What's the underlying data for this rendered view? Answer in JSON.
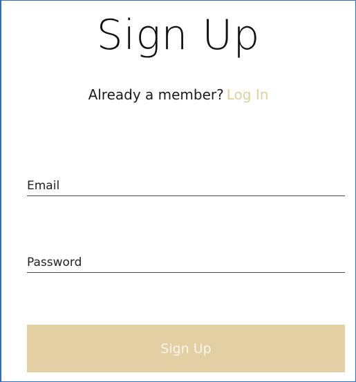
{
  "form": {
    "title": "Sign Up",
    "member_prompt": "Already a member?",
    "login_link": "Log In",
    "email_label": "Email",
    "email_value": "",
    "password_label": "Password",
    "password_value": "",
    "submit_label": "Sign Up"
  },
  "colors": {
    "accent": "#e3cfa4",
    "link": "#e3cf9e",
    "frame_border": "#2f6bbf"
  }
}
